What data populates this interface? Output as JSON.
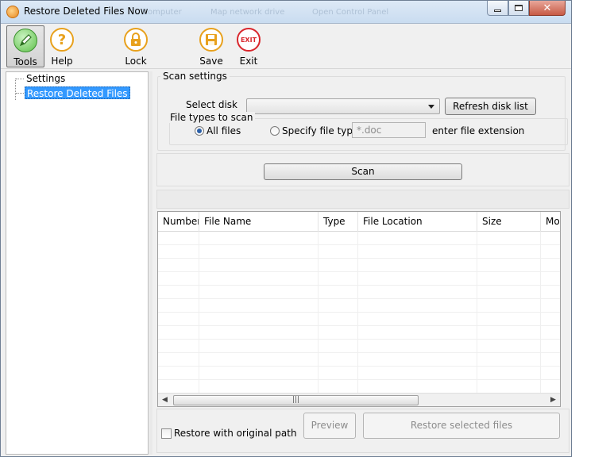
{
  "window": {
    "title": "Restore Deleted Files Now",
    "ghost_tabs": [
      "Computer",
      "Map network drive",
      "Open Control Panel"
    ],
    "controls": {
      "minimize": "minimize",
      "maximize": "maximize",
      "close": "✕"
    }
  },
  "toolbar": {
    "buttons": [
      {
        "label": "Tools",
        "icon": "pencil-icon",
        "active": true
      },
      {
        "label": "Help",
        "icon": "question-icon",
        "glyph": "?"
      },
      {
        "label": "Lock",
        "icon": "lock-icon"
      },
      {
        "label": "Save",
        "icon": "save-icon"
      },
      {
        "label": "Exit",
        "icon": "exit-icon",
        "glyph": "EXIT"
      }
    ]
  },
  "tree": {
    "items": [
      {
        "label": "Settings",
        "selected": false
      },
      {
        "label": "Restore Deleted Files",
        "selected": true
      }
    ]
  },
  "scan_settings": {
    "group_label": "Scan settings",
    "select_disk_label": "Select disk",
    "select_disk_value": "",
    "refresh_button": "Refresh disk list",
    "file_types_label": "File types to scan",
    "all_files_label": "All files",
    "all_files_checked": true,
    "specify_type_label": "Specify file type",
    "specify_type_checked": false,
    "extension_value": "*.doc",
    "extension_hint": "enter file extension"
  },
  "scan_button": "Scan",
  "results_table": {
    "columns": [
      "Number",
      "File Name",
      "Type",
      "File Location",
      "Size",
      "Moc"
    ],
    "rows": []
  },
  "bottom": {
    "restore_original_path_label": "Restore with original path",
    "restore_original_path_checked": false,
    "preview_button": "Preview",
    "restore_selected_button": "Restore selected files"
  },
  "colors": {
    "selection": "#3399ff",
    "exit_red": "#d9262c",
    "icon_orange": "#e8a11d",
    "tools_green": "#5fc04a"
  }
}
